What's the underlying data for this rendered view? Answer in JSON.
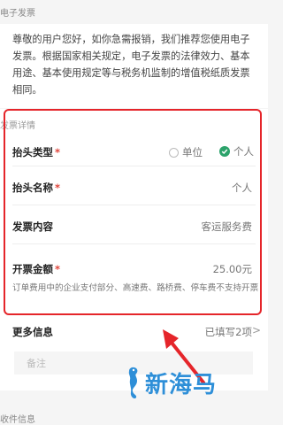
{
  "header": {
    "title": "电子发票"
  },
  "notice": {
    "text": "尊敬的用户您好，如你急需报销，我们推荐您使用电子发票。根据国家相关规定，电子发票的法律效力、基本用途、基本使用规定等与税务机监制的增值税纸质发票相同。"
  },
  "invoice": {
    "title": "发票详情",
    "header_type": {
      "label": "抬头类型",
      "required": "*",
      "options": [
        "单位",
        "个人"
      ],
      "selected": "个人"
    },
    "header_name": {
      "label": "抬头名称",
      "required": "*",
      "value": "个人"
    },
    "content": {
      "label": "发票内容",
      "value": "客运服务费"
    },
    "amount": {
      "label": "开票金额",
      "required": "*",
      "value": "25.00元"
    },
    "note": "订单费用中的企业支付部分、高速费、路桥费、停车费不支持开票"
  },
  "more": {
    "label": "更多信息",
    "value": "已填写2项",
    "chevron": ">"
  },
  "remark": {
    "placeholder": "备注"
  },
  "receiver": {
    "title": "收件信息"
  },
  "watermark": {
    "text": "新海马"
  },
  "colors": {
    "accent": "#2ca36b",
    "required": "#e0443a",
    "highlight": "#e5252a",
    "watermark": "#2e8fd8"
  }
}
